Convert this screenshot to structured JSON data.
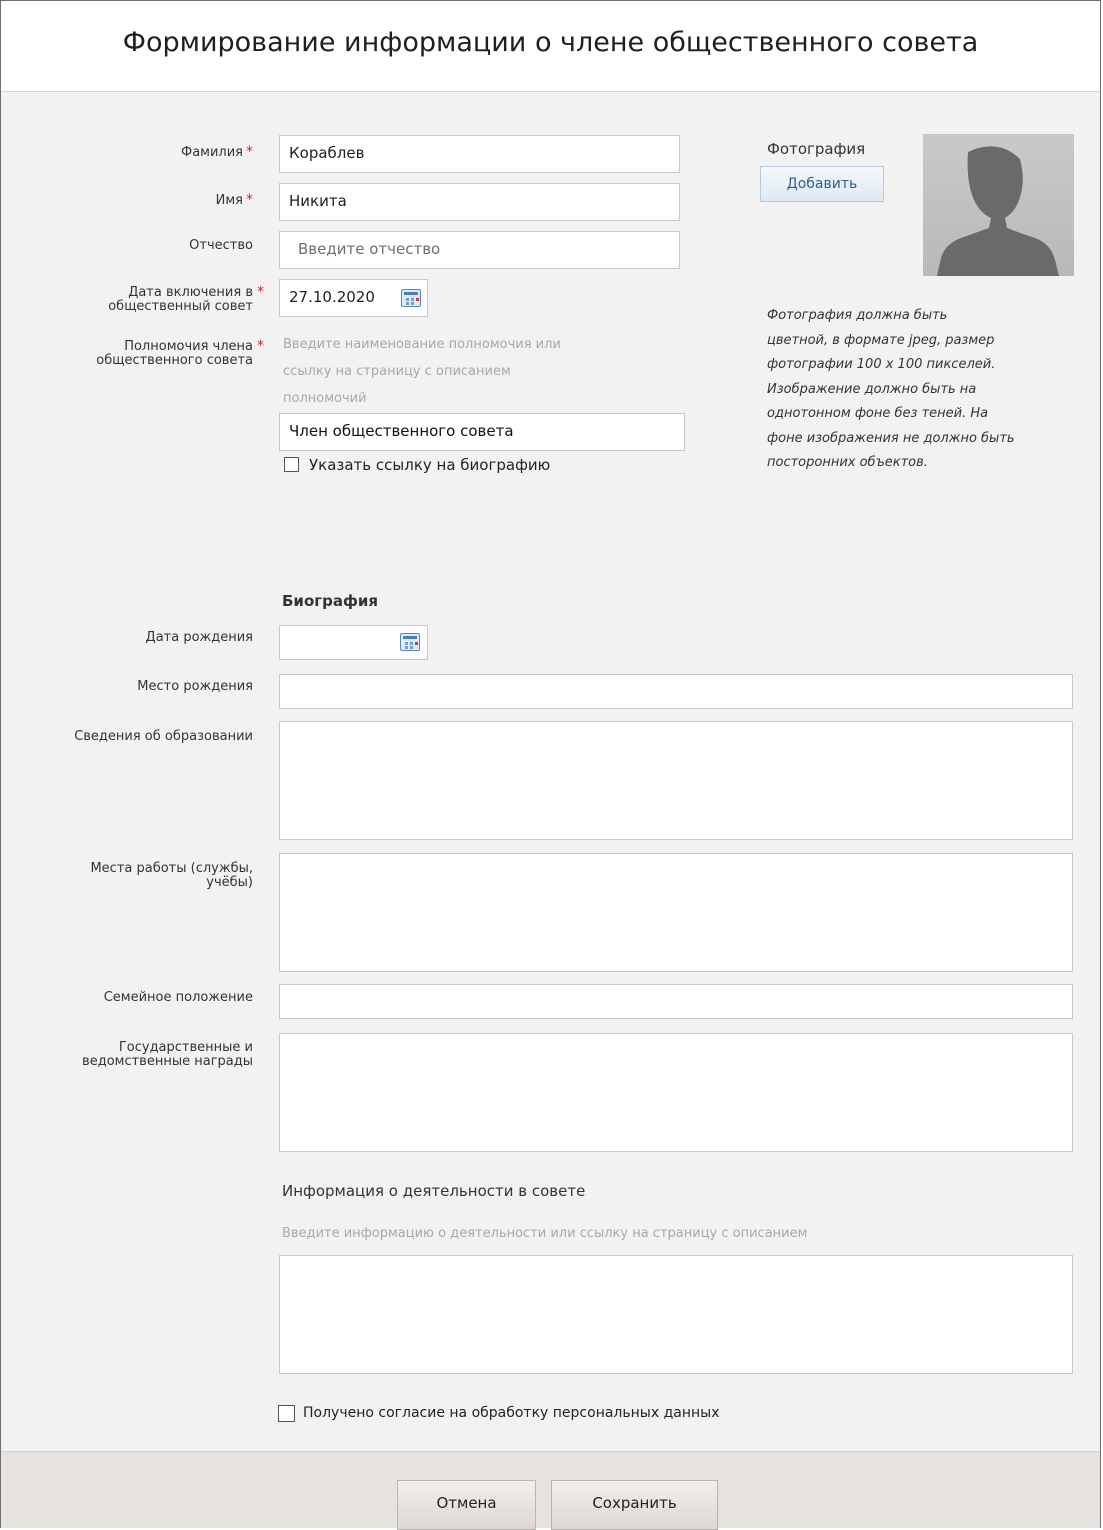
{
  "dialog": {
    "title": "Формирование информации о члене общественного совета"
  },
  "form": {
    "surname": {
      "label": "Фамилия",
      "value": "Кораблев"
    },
    "name": {
      "label": "Имя",
      "value": "Никита"
    },
    "patronymic": {
      "label": "Отчество",
      "placeholder": "Введите отчество"
    },
    "inclusion_date": {
      "label_line1": "Дата включения в",
      "label_line2": "общественный совет",
      "value": "27.10.2020"
    },
    "authority": {
      "label_line1": "Полномочия члена",
      "label_line2": "общественного совета",
      "hint_line1": "Введите наименование полномочия или",
      "hint_line2": "ссылку на страницу с описанием",
      "hint_line3": "полномочий",
      "value": "Член общественного совета"
    },
    "bio_link_checkbox": {
      "label": "Указать ссылку на биографию",
      "checked": false
    },
    "required_mark": "*"
  },
  "photo": {
    "label": "Фотография",
    "add_button": "Добавить",
    "note_lines": [
      "Фотография должна быть",
      "цветной, в формате jpeg, размер",
      "фотографии 100 х 100 пикселей.",
      "Изображение должно быть на",
      "однотонном фоне без теней. На",
      "фоне изображения не должно быть",
      "посторонних объектов."
    ]
  },
  "biography": {
    "title": "Биография",
    "birth_date": {
      "label": "Дата рождения",
      "value": ""
    },
    "birth_place": {
      "label": "Место рождения",
      "value": ""
    },
    "education": {
      "label": "Сведения об образовании",
      "value": ""
    },
    "work_places": {
      "label_line1": "Места работы (службы,",
      "label_line2": "учёбы)",
      "value": ""
    },
    "family_status": {
      "label": "Семейное положение",
      "value": ""
    },
    "awards": {
      "label_line1": "Государственные и",
      "label_line2": "ведомственные награды",
      "value": ""
    }
  },
  "activity": {
    "title": "Информация о деятельности в совете",
    "hint": "Введите информацию о деятельности или ссылку на страницу с описанием",
    "value": ""
  },
  "consent_checkbox": {
    "label": "Получено согласие на обработку персональных данных",
    "checked": false
  },
  "footer": {
    "cancel_label": "Отмена",
    "save_label": "Сохранить"
  },
  "colors": {
    "required": "#e02020",
    "footer_bg": "#e6e3df",
    "accent": "#2a5f96"
  },
  "icons": {
    "calendar": "calendar-icon",
    "avatar": "person-silhouette-icon"
  }
}
